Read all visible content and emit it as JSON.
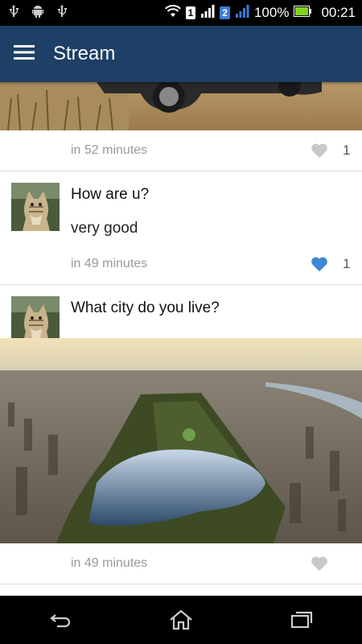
{
  "status_bar": {
    "sim1": "1",
    "sim2": "2",
    "battery": "100%",
    "time": "00:21"
  },
  "app_bar": {
    "title": "Stream",
    "menu_icon": "hamburger-menu-icon"
  },
  "posts": [
    {
      "image": "desert-car-photo",
      "time": "in 52 minutes",
      "liked": false,
      "likes": "1"
    },
    {
      "avatar": "cat-avatar",
      "title": "How are u?",
      "body": "very good",
      "time": "in 49 minutes",
      "liked": true,
      "likes": "1"
    },
    {
      "avatar": "cat-avatar",
      "title": "What city do you live?",
      "image": "aerial-city-park-photo",
      "time": "in 49 minutes",
      "liked": false,
      "likes": ""
    }
  ],
  "colors": {
    "app_bar": "#1e4066",
    "like_active": "#3b86d6",
    "like_inactive": "#c8c8c8"
  },
  "nav_bar": [
    "back-icon",
    "home-icon",
    "recent-apps-icon"
  ]
}
